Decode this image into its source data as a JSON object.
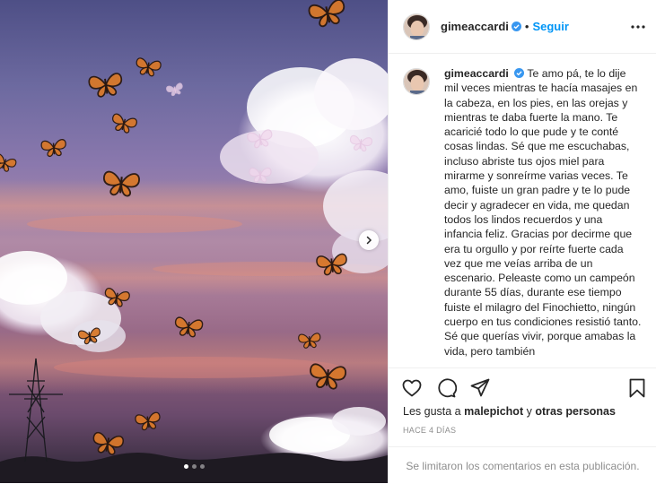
{
  "post": {
    "username": "gimeaccardi",
    "follow_label": "Seguir",
    "separator": "•",
    "caption_user": "gimeaccardi",
    "caption_text": "Te amo pá, te lo dije mil veces mientras te hacía masajes en la cabeza, en los pies, en las orejas y mientras te daba fuerte la mano. Te acaricié todo lo que pude y te conté cosas lindas. Sé que me escuchabas, incluso abriste tus ojos miel para mirarme y sonreírme varias veces. Te amo, fuiste un gran padre y te lo pude decir y agradecer en vida, me quedan todos los lindos recuerdos y una infancia feliz. Gracias por decirme que era tu orgullo y por reírte fuerte cada vez que me veías arriba de un escenario. Peleaste como un campeón durante 55 días, durante ese tiempo fuiste el milagro del Finochietto, ningún cuerpo en tus condiciones resistió tanto. Sé que querías vivir, porque amabas la vida, pero también",
    "likes_prefix": "Les gusta a",
    "likes_user": "malepichot",
    "likes_connector": "y",
    "likes_others": "otras personas",
    "timestamp": "Hace 4 días",
    "comments_limited": "Se limitaron los comentarios en esta publicación."
  },
  "carousel": {
    "current": 1,
    "total": 3
  },
  "icons": {
    "verified": "verified-badge-icon",
    "more": "more-options-icon",
    "next": "chevron-right-icon",
    "like": "heart-icon",
    "comment": "comment-icon",
    "share": "share-icon",
    "save": "bookmark-icon"
  },
  "colors": {
    "link": "#0095f6",
    "verified": "#3897f0",
    "muted": "#8e8e8e",
    "text": "#262626"
  }
}
